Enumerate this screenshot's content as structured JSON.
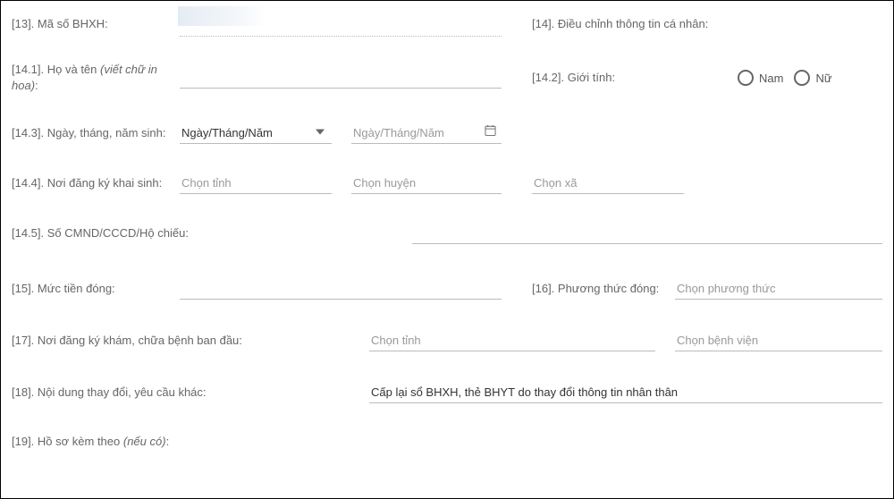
{
  "f13": {
    "label": "[13]. Mã số BHXH:"
  },
  "f14": {
    "label": "[14]. Điều chỉnh thông tin cá nhân:"
  },
  "f14_1": {
    "label_a": "[14.1]. Họ và tên ",
    "label_b": "(viết chữ in hoa)",
    "label_c": ":"
  },
  "f14_2": {
    "label": "[14.2]. Giới tính:",
    "opt_nam": "Nam",
    "opt_nu": "Nữ"
  },
  "f14_3": {
    "label": "[14.3]. Ngày, tháng, năm sinh:",
    "select_placeholder": "Ngày/Tháng/Năm",
    "date_placeholder": "Ngày/Tháng/Năm"
  },
  "f14_4": {
    "label": "[14.4]. Nơi đăng ký khai sinh:",
    "ph_tinh": "Chọn tỉnh",
    "ph_huyen": "Chọn huyện",
    "ph_xa": "Chọn xã"
  },
  "f14_5": {
    "label": "[14.5]. Số CMND/CCCD/Hộ chiếu:"
  },
  "f15": {
    "label": "[15]. Mức tiền đóng:"
  },
  "f16": {
    "label": "[16]. Phương thức đóng:",
    "ph": "Chọn phương thức"
  },
  "f17": {
    "label": "[17]. Nơi đăng ký khám, chữa bệnh ban đầu:",
    "ph_tinh": "Chọn tỉnh",
    "ph_bv": "Chọn bệnh viện"
  },
  "f18": {
    "label": "[18]. Nội dung thay đổi, yêu cầu khác:",
    "value": "Cấp lại sổ BHXH, thẻ BHYT do thay đổi thông tin nhân thân"
  },
  "f19": {
    "label_a": "[19]. Hồ sơ kèm theo ",
    "label_b": "(nếu có)",
    "label_c": ":"
  }
}
